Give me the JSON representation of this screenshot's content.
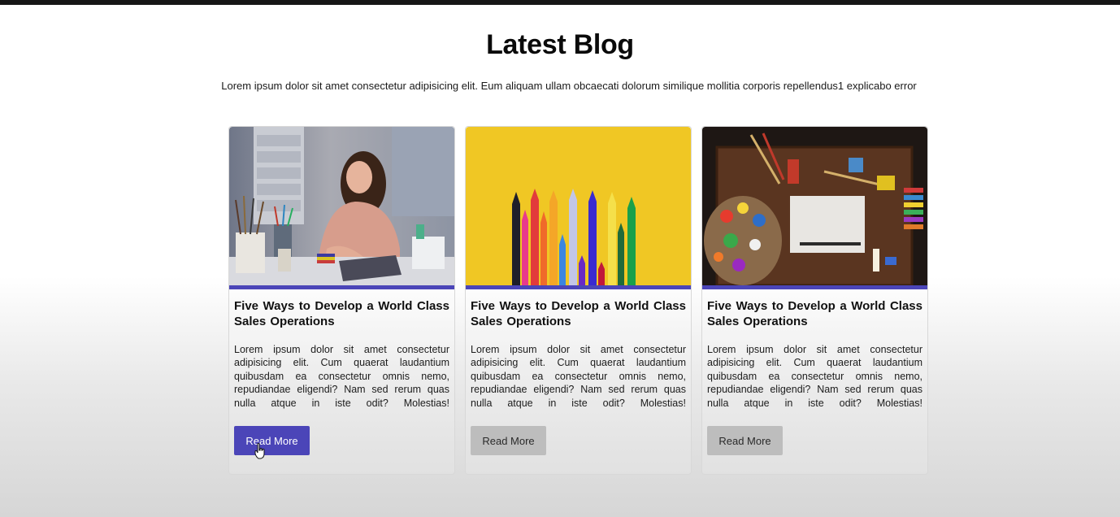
{
  "page": {
    "title": "Latest Blog",
    "subtitle": "Lorem ipsum dolor sit amet consectetur adipisicing elit. Eum aliquam ullam obcaecati dolorum similique mollitia corporis repellendus1 explicabo error"
  },
  "colors": {
    "accent": "#4b45b8",
    "button_inactive": "#bdbdbd",
    "top_bar": "#161616"
  },
  "cards": [
    {
      "image": "woman-painting-photo",
      "title": "Five Ways to Develop a World Class Sales Operations",
      "body": "Lorem ipsum dolor sit amet consectetur adipisicing elit. Cum quaerat laudantium quibusdam ea consectetur omnis nemo, repudiandae eligendi? Nam sed rerum quas nulla atque in iste odit? Molestias!",
      "button_label": "Read More",
      "button_state": "hovered"
    },
    {
      "image": "colored-pencils-photo",
      "title": "Five Ways to Develop a World Class Sales Operations",
      "body": "Lorem ipsum dolor sit amet consectetur adipisicing elit. Cum quaerat laudantium quibusdam ea consectetur omnis nemo, repudiandae eligendi? Nam sed rerum quas nulla atque in iste odit? Molestias!",
      "button_label": "Read More",
      "button_state": "default"
    },
    {
      "image": "paint-palette-desk-photo",
      "title": "Five Ways to Develop a World Class Sales Operations",
      "body": "Lorem ipsum dolor sit amet consectetur adipisicing elit. Cum quaerat laudantium quibusdam ea consectetur omnis nemo, repudiandae eligendi? Nam sed rerum quas nulla atque in iste odit? Molestias!",
      "button_label": "Read More",
      "button_state": "default"
    }
  ]
}
